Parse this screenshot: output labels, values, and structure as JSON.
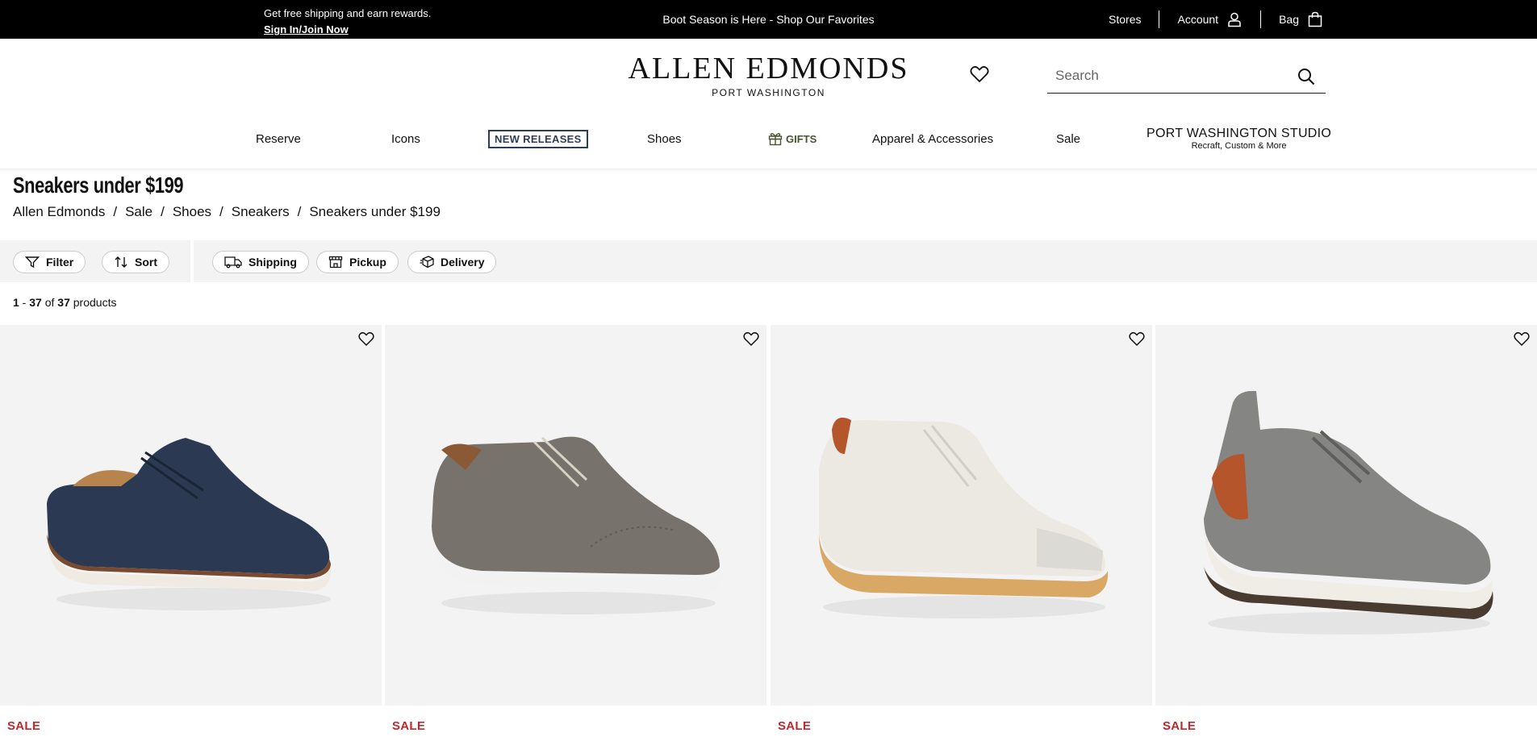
{
  "promo": {
    "left_line1": "Get free shipping and earn rewards.",
    "left_line2": "Sign In/Join Now",
    "center": "Boot Season is Here - Shop Our Favorites",
    "stores": "Stores",
    "account": "Account",
    "bag": "Bag"
  },
  "header": {
    "brand": "ALLEN EDMONDS",
    "sub": "PORT WASHINGTON",
    "search_placeholder": "Search"
  },
  "nav": {
    "reserve": "Reserve",
    "icons": "Icons",
    "new_releases": "NEW RELEASES",
    "shoes": "Shoes",
    "gifts": "GIFTS",
    "apparel": "Apparel & Accessories",
    "sale": "Sale",
    "studio": "PORT WASHINGTON STUDIO",
    "studio_sub": "Recraft, Custom & More"
  },
  "page": {
    "title": "Sneakers under $199",
    "breadcrumb": [
      "Allen Edmonds",
      "Sale",
      "Shoes",
      "Sneakers",
      "Sneakers under $199"
    ]
  },
  "filters": {
    "filter": "Filter",
    "sort": "Sort",
    "shipping": "Shipping",
    "pickup": "Pickup",
    "delivery": "Delivery"
  },
  "results": {
    "start": "1",
    "end": "37",
    "total": "37",
    "of": "of",
    "suffix": "products"
  },
  "products": [
    {
      "label": "SALE",
      "color": "#2b3a52",
      "sole": "#efeae2"
    },
    {
      "label": "SALE",
      "color": "#77736c",
      "sole": "#f2f2f2"
    },
    {
      "label": "SALE",
      "color": "#ece9e2",
      "sole": "#d9a865"
    },
    {
      "label": "SALE",
      "color": "#858583",
      "sole": "#f0ece6"
    }
  ],
  "colors": {
    "sale_red": "#c0282e",
    "nav_new": "#2d3e55"
  }
}
